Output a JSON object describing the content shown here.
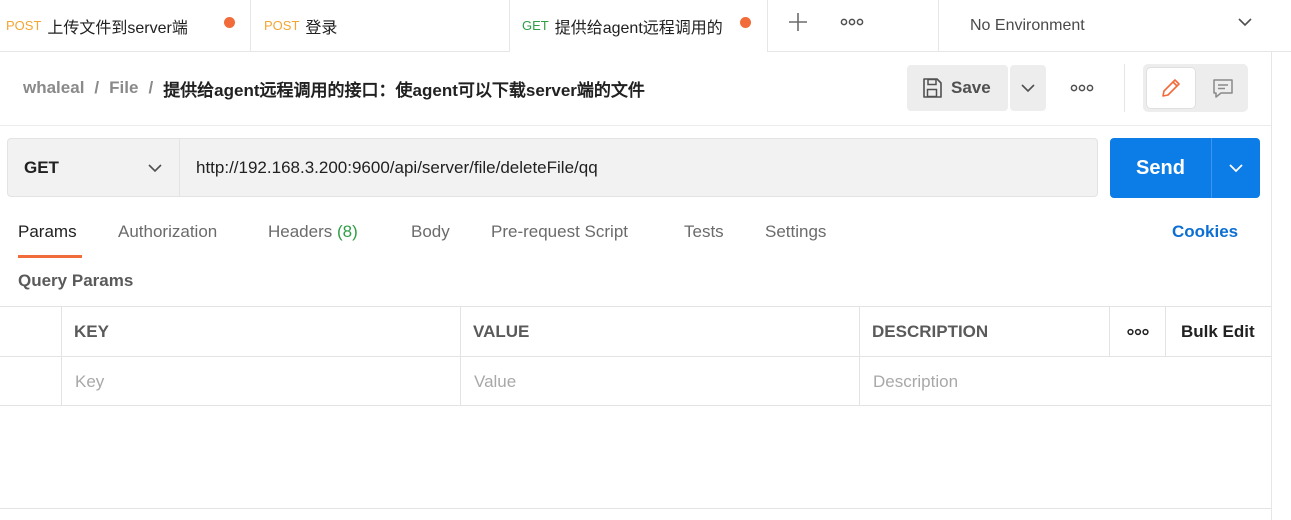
{
  "tabs": [
    {
      "method": "POST",
      "title": "上传文件到server端",
      "unsaved": true
    },
    {
      "method": "POST",
      "title": "登录",
      "unsaved": false
    },
    {
      "method": "GET",
      "title": "提供给agent远程调用的",
      "unsaved": true,
      "active": true
    }
  ],
  "environment": {
    "selected": "No Environment"
  },
  "breadcrumb": {
    "workspace": "whaleal",
    "separator": "/",
    "folder": "File",
    "request": "提供给agent远程调用的接口：使agent可以下载server端的文件"
  },
  "toolbar": {
    "save_label": "Save"
  },
  "request": {
    "method": "GET",
    "url": "http://192.168.3.200:9600/api/server/file/deleteFile/qq",
    "send_label": "Send"
  },
  "request_tabs": [
    {
      "label": "Params",
      "active": true
    },
    {
      "label": "Authorization"
    },
    {
      "label": "Headers",
      "count": "(8)"
    },
    {
      "label": "Body"
    },
    {
      "label": "Pre-request Script"
    },
    {
      "label": "Tests"
    },
    {
      "label": "Settings"
    }
  ],
  "cookies_label": "Cookies",
  "query_params": {
    "title": "Query Params",
    "columns": [
      "KEY",
      "VALUE",
      "DESCRIPTION"
    ],
    "bulk_edit_label": "Bulk Edit",
    "placeholders": {
      "key": "Key",
      "value": "Value",
      "description": "Description"
    }
  },
  "colors": {
    "accent": "#0c7ce6",
    "unsaved_dot": "#f26b3a",
    "post_method": "#f4a632",
    "get_method": "#2f9e44",
    "link": "#0c6fd1"
  },
  "icons": {
    "new_tab": "plus-icon",
    "tab_options": "more-horizontal-icon",
    "environment_dropdown": "chevron-down-icon",
    "save": "save-icon",
    "save_dropdown": "chevron-down-icon",
    "request_options": "more-horizontal-icon",
    "edit": "pencil-icon",
    "comments": "comment-icon",
    "method_dropdown": "chevron-down-icon",
    "send_dropdown": "chevron-down-icon",
    "column_options": "more-horizontal-icon"
  }
}
